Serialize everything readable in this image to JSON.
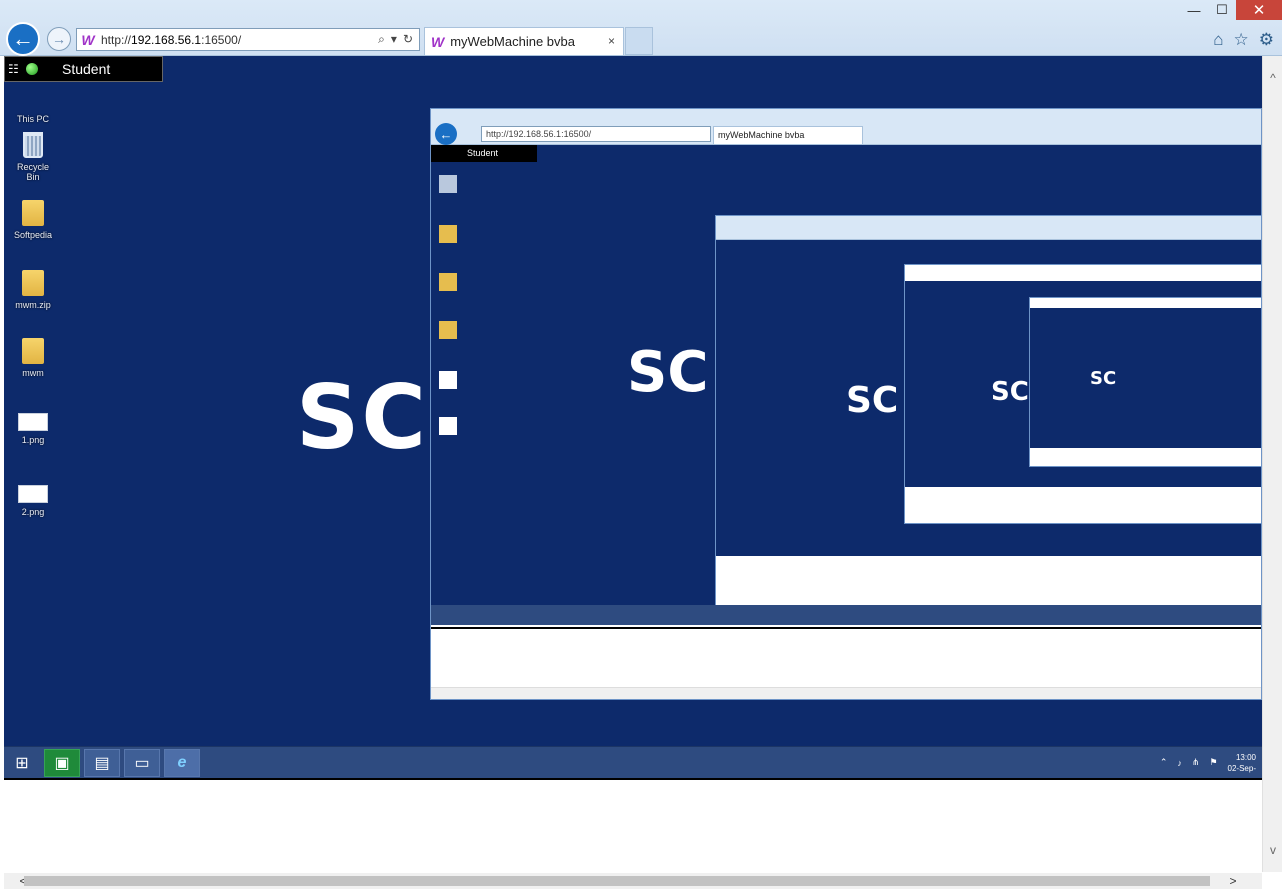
{
  "window": {
    "minimize": "—",
    "maximize": "☐",
    "close": "✕"
  },
  "address": {
    "url_prefix": "http://",
    "url_host": "192.168.56.1",
    "url_port": ":16500/",
    "logo": "W"
  },
  "tab": {
    "title": "myWebMachine bvba",
    "logo": "W",
    "close": "×"
  },
  "ie_icons": [
    "home-icon",
    "star-icon",
    "gear-icon"
  ],
  "remote": {
    "user": "Student",
    "brand": "SC"
  },
  "desktop_icons": [
    {
      "label": "This PC",
      "type": "pc"
    },
    {
      "label": "Recycle Bin",
      "type": "bin"
    },
    {
      "label": "Softpedia",
      "type": "folder"
    },
    {
      "label": "mwm.zip",
      "type": "zip"
    },
    {
      "label": "mwm",
      "type": "folder"
    },
    {
      "label": "1.png",
      "type": "png"
    },
    {
      "label": "2.png",
      "type": "png"
    }
  ],
  "taskbar": {
    "clock_time": "13:00",
    "clock_date": "02-Sep-"
  },
  "nested": {
    "url": "http://192.168.56.1:16500/",
    "tab_title": "myWebMachine bvba",
    "user": "Student",
    "brand": "SC"
  },
  "colors": {
    "desktop_bg": "#0d2a6b",
    "taskbar": "#2e4b80",
    "accent": "#1a6fc4",
    "brand_logo": "#a033c8"
  }
}
